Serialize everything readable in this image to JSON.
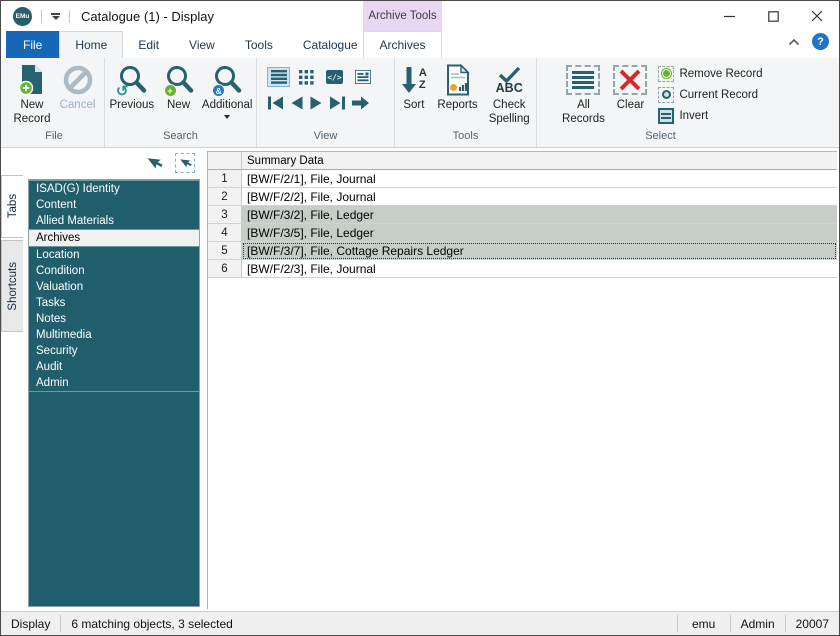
{
  "titlebar": {
    "app_logo": "EMu",
    "title": "Catalogue (1) - Display",
    "contextual_tab": "Archive Tools"
  },
  "ribbon_tabs": [
    {
      "label": "File"
    },
    {
      "label": "Home",
      "active": true
    },
    {
      "label": "Edit"
    },
    {
      "label": "View"
    },
    {
      "label": "Tools"
    },
    {
      "label": "Catalogue"
    },
    {
      "label": "Archives",
      "contextual": true
    }
  ],
  "help_glyph": "?",
  "ribbon": {
    "file_group": {
      "label": "File",
      "new_record": "New Record",
      "cancel": "Cancel"
    },
    "search_group": {
      "label": "Search",
      "previous": "Previous",
      "new": "New",
      "additional": "Additional",
      "additional_badge": "&"
    },
    "view_group": {
      "label": "View"
    },
    "tools_group": {
      "label": "Tools",
      "sort": "Sort",
      "sort_a": "A",
      "sort_z": "Z",
      "reports": "Reports",
      "check_spelling": "Check Spelling",
      "abc": "ABC"
    },
    "select_group": {
      "label": "Select",
      "all_records": "All Records",
      "clear": "Clear",
      "remove_record": "Remove Record",
      "current_record": "Current Record",
      "invert": "Invert"
    }
  },
  "side_tabs": [
    {
      "label": "Tabs",
      "active": true
    },
    {
      "label": "Shortcuts"
    }
  ],
  "sidebar": {
    "items": [
      {
        "label": "ISAD(G) Identity"
      },
      {
        "label": "Content"
      },
      {
        "label": "Allied Materials"
      },
      {
        "label": "Archives",
        "selected": true
      },
      {
        "label": "Location"
      },
      {
        "label": "Condition"
      },
      {
        "label": "Valuation"
      },
      {
        "label": "Tasks"
      },
      {
        "label": "Notes"
      },
      {
        "label": "Multimedia"
      },
      {
        "label": "Security"
      },
      {
        "label": "Audit"
      },
      {
        "label": "Admin"
      }
    ]
  },
  "table": {
    "column_header": "Summary Data",
    "rows": [
      {
        "num": "1",
        "summary": "[BW/F/2/1], File, Journal",
        "selected": false
      },
      {
        "num": "2",
        "summary": "[BW/F/2/2], File, Journal",
        "selected": false
      },
      {
        "num": "3",
        "summary": "[BW/F/3/2], File, Ledger",
        "selected": true
      },
      {
        "num": "4",
        "summary": "[BW/F/3/5], File, Ledger",
        "selected": true
      },
      {
        "num": "5",
        "summary": "[BW/F/3/7], File, Cottage Repairs Ledger",
        "selected": true,
        "focused": true
      },
      {
        "num": "6",
        "summary": "[BW/F/2/3], File, Journal",
        "selected": false
      }
    ]
  },
  "statusbar": {
    "mode": "Display",
    "message": "6 matching objects, 3 selected",
    "user": "emu",
    "group": "Admin",
    "code": "20007"
  },
  "colors": {
    "icon_teal": "#27606f",
    "sidebar_teal": "#215e6b",
    "file_tab_blue": "#1667b8",
    "contextual_lavender": "#e7d7f3",
    "selection_green": "#c5cfc8",
    "clear_red": "#d42a2a",
    "plus_green": "#65b32e",
    "badge_blue": "#1f7ac9"
  }
}
